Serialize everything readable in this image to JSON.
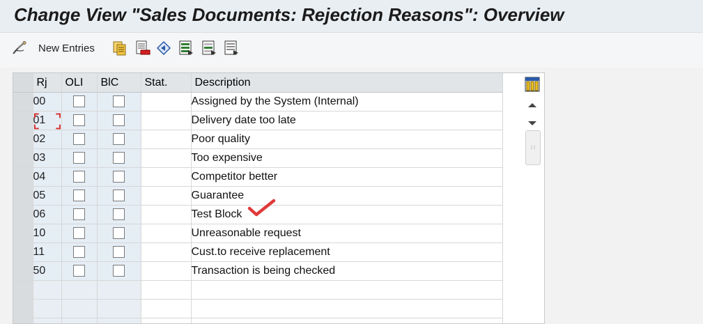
{
  "title": "Change View \"Sales Documents: Rejection Reasons\": Overview",
  "toolbar": {
    "new_entries_label": "New Entries",
    "icons": [
      "glasses-icon",
      "copy-icon",
      "delete-icon",
      "undo-icon",
      "select-all-icon",
      "select-block-icon",
      "deselect-all-icon"
    ]
  },
  "table": {
    "headers": {
      "rj": "Rj",
      "oli": "OLI",
      "blc": "BlC",
      "stat": "Stat.",
      "desc": "Description"
    },
    "rows": [
      {
        "rj": "00",
        "description": "Assigned by the System (Internal)"
      },
      {
        "rj": "01",
        "description": "Delivery date too late"
      },
      {
        "rj": "02",
        "description": "Poor quality"
      },
      {
        "rj": "03",
        "description": "Too expensive"
      },
      {
        "rj": "04",
        "description": "Competitor better"
      },
      {
        "rj": "05",
        "description": "Guarantee"
      },
      {
        "rj": "06",
        "description": "Test Block"
      },
      {
        "rj": "10",
        "description": "Unreasonable request"
      },
      {
        "rj": "11",
        "description": "Cust.to receive replacement"
      },
      {
        "rj": "50",
        "description": "Transaction is being checked"
      }
    ]
  },
  "colors": {
    "accent_mark": "#e03a3a",
    "focus_bracket": "#d62828"
  }
}
